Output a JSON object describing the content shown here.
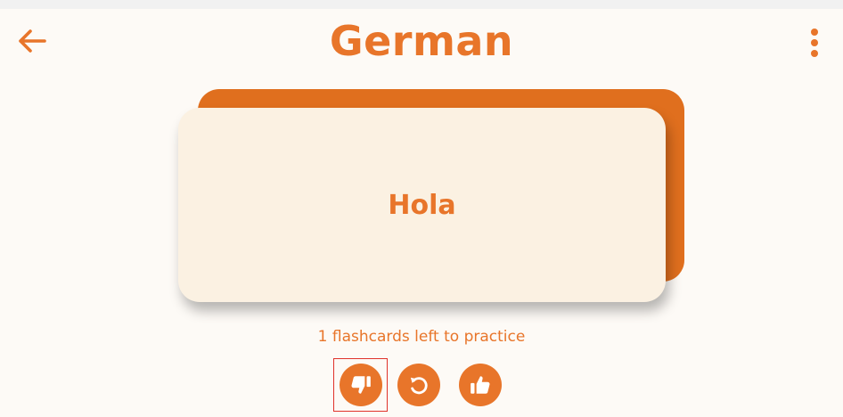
{
  "header": {
    "title": "German",
    "back_icon": "arrow-left-icon",
    "menu_icon": "more-vertical-icon"
  },
  "card": {
    "front_text": "Hola"
  },
  "status": {
    "remaining_text": "1 flashcards left to practice"
  },
  "actions": [
    {
      "name": "dislike",
      "icon": "thumbs-down-icon"
    },
    {
      "name": "repeat",
      "icon": "rotate-ccw-icon"
    },
    {
      "name": "like",
      "icon": "thumbs-up-icon"
    }
  ],
  "colors": {
    "accent": "#e8752a",
    "card_back": "#e06f1e",
    "card_front": "#fbf1e2",
    "background": "#fdfaf6",
    "highlight_border": "#e0332b"
  }
}
